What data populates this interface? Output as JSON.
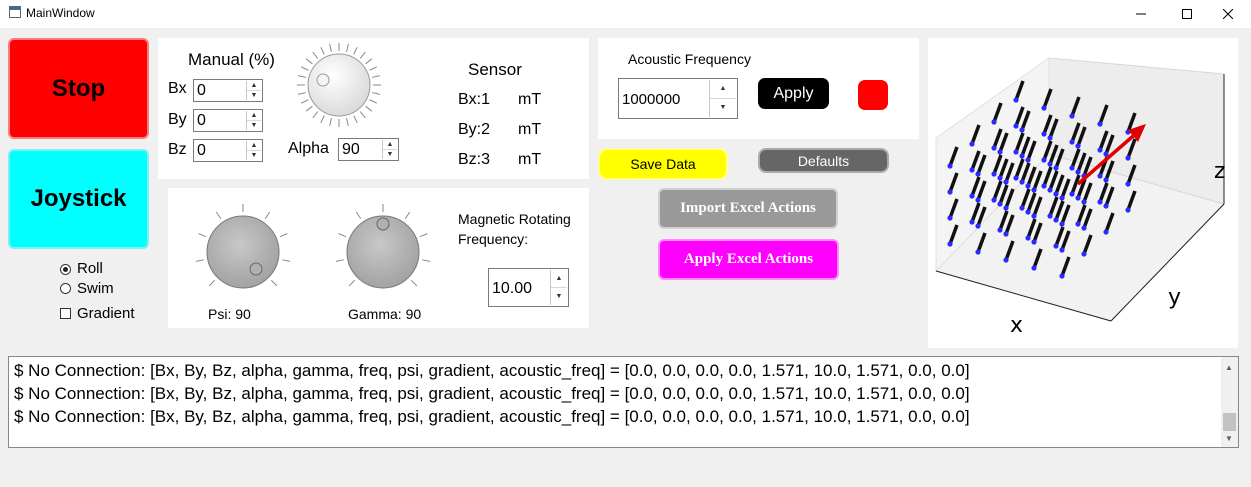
{
  "window": {
    "title": "MainWindow",
    "icons": [
      "app-icon",
      "minimize-icon",
      "maximize-icon",
      "close-icon"
    ]
  },
  "left": {
    "stop_label": "Stop",
    "joystick_label": "Joystick",
    "colors": {
      "stop": "#ff0000",
      "joystick": "#00ffff"
    },
    "modes": [
      {
        "label": "Roll",
        "selected": true
      },
      {
        "label": "Swim",
        "selected": false
      }
    ],
    "gradient_label": "Gradient",
    "gradient_checked": false
  },
  "manual": {
    "title": "Manual (%)",
    "bx_label": "Bx",
    "bx_value": "0",
    "by_label": "By",
    "by_value": "0",
    "bz_label": "Bz",
    "bz_value": "0",
    "alpha_label": "Alpha",
    "alpha_value": "90"
  },
  "sensor": {
    "title": "Sensor",
    "rows": [
      {
        "label": "Bx:1",
        "unit": "mT"
      },
      {
        "label": "By:2",
        "unit": "mT"
      },
      {
        "label": "Bz:3",
        "unit": "mT"
      }
    ]
  },
  "dials": {
    "psi_label": "Psi: 90",
    "gamma_label": "Gamma: 90",
    "freq_label_1": "Magnetic Rotating",
    "freq_label_2": "Frequency:",
    "freq_value": "10.00"
  },
  "acoustic": {
    "title": "Acoustic Frequency",
    "value": "1000000",
    "apply_label": "Apply",
    "indicator_color": "#ff0000"
  },
  "actions": {
    "save_label": "Save Data",
    "defaults_label": "Defaults",
    "import_label": "Import Excel Actions",
    "apply_excel_label": "Apply Excel Actions",
    "colors": {
      "save": "#ffff00",
      "defaults": "#666666",
      "import": "#999999",
      "apply_excel": "#ff00ff"
    }
  },
  "plot": {
    "xlabel": "x",
    "ylabel": "y",
    "zlabel": "z"
  },
  "console": {
    "lines": [
      "$ No Connection:  [Bx, By, Bz, alpha, gamma, freq, psi, gradient, acoustic_freq] = [0.0, 0.0, 0.0, 0.0, 1.571, 10.0, 1.571, 0.0, 0.0]",
      "$ No Connection:  [Bx, By, Bz, alpha, gamma, freq, psi, gradient, acoustic_freq] = [0.0, 0.0, 0.0, 0.0, 1.571, 10.0, 1.571, 0.0, 0.0]",
      "$ No Connection:  [Bx, By, Bz, alpha, gamma, freq, psi, gradient, acoustic_freq] = [0.0, 0.0, 0.0, 0.0, 1.571, 10.0, 1.571, 0.0, 0.0]"
    ]
  }
}
